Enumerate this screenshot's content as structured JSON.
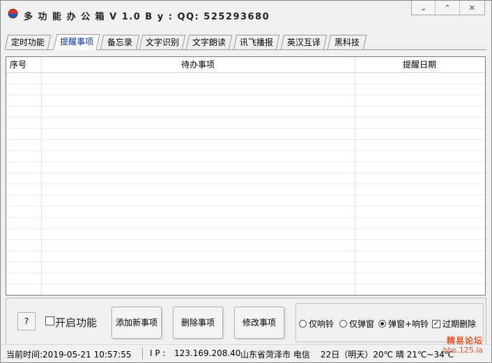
{
  "window": {
    "title": "多 功 能 办 公 箱 V 1.0    B y : QQ:  525293680",
    "min_glyph": "⌄",
    "max_glyph": "⌃",
    "close_glyph": "✕"
  },
  "tabs": [
    {
      "label": "定时功能",
      "active": false
    },
    {
      "label": "提醒事项",
      "active": true
    },
    {
      "label": "备忘录",
      "active": false
    },
    {
      "label": "文字识别",
      "active": false
    },
    {
      "label": "文字朗读",
      "active": false
    },
    {
      "label": "讯飞播报",
      "active": false
    },
    {
      "label": "英汉互译",
      "active": false
    },
    {
      "label": "黑科技",
      "active": false
    }
  ],
  "table": {
    "columns": [
      "序号",
      "待办事项",
      "提醒日期"
    ],
    "rows": []
  },
  "controls": {
    "help_label": "?",
    "enable_label": "开启功能",
    "enable_checked": false,
    "add_label": "添加新事项",
    "delete_label": "删除事项",
    "edit_label": "修改事项",
    "opt_ring_label": "仅响铃",
    "opt_popup_label": "仅弹窗",
    "opt_both_label": "弹窗+响铃",
    "selected_option": "弹窗+响铃",
    "expire_delete_label": "过期删除",
    "expire_delete_checked": true
  },
  "status": {
    "time_text": "当前时间:2019-05-21 10:57:55",
    "ip_label": "I P :",
    "ip_value": "123.169.208.40",
    "location": "山东省菏泽市 电信",
    "weather": "22日（明天）20℃ 晴 21℃~34℃"
  },
  "watermark": {
    "line1": "精易论坛",
    "line2": "bbs.125.la"
  },
  "colors": {
    "active_tab_text": "#0a2ea0",
    "watermark": "#e4572e",
    "icon_red": "#d9342b",
    "icon_blue": "#1c58b8"
  }
}
